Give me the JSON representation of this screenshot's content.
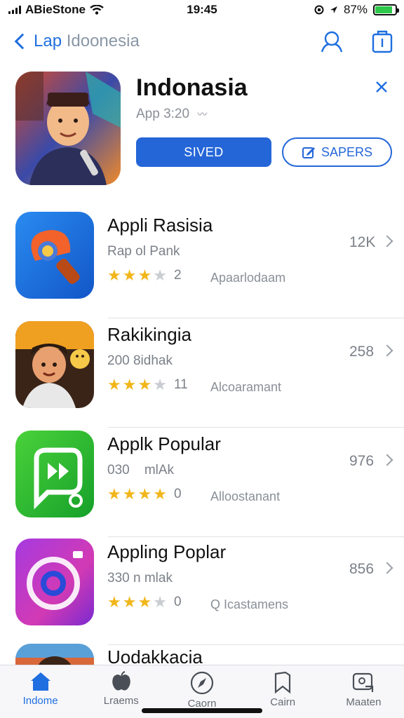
{
  "status_bar": {
    "carrier": "ABieStone",
    "time": "19:45",
    "battery": "87%",
    "battery_level": 0.87
  },
  "nav": {
    "back_label_prefix": "Lap",
    "back_label_rest": "Idoonesia"
  },
  "featured": {
    "title": "Indonasia",
    "subtitle": "App 3:20",
    "primary_button": "SIVED",
    "secondary_button": "SAPERS"
  },
  "apps": [
    {
      "name": "Appli Rasisia",
      "subtitle": "Rap ol Pank",
      "rating": 3,
      "rating_count": "2",
      "category": "Apaarlodaam",
      "size": "12K"
    },
    {
      "name": "Rakikingia",
      "subtitle": "200 8idhak",
      "rating": 3,
      "rating_count": "11",
      "category": "Alcoaramant",
      "size": "258"
    },
    {
      "name": "Applk Popular",
      "subtitle": "030    mlAk",
      "rating": 4,
      "rating_count": "0",
      "category": "Alloostanant",
      "size": "976"
    },
    {
      "name": "Appling Poplar",
      "subtitle": "330 n mlak",
      "rating": 3,
      "rating_count": "0",
      "category": "Q Icastamens",
      "size": "856"
    },
    {
      "name": "Uodakkacia",
      "subtitle": "",
      "rating": 0,
      "rating_count": "",
      "category": "",
      "size": ""
    }
  ],
  "tabs": [
    {
      "label": "Indome",
      "icon": "home-icon",
      "active": true
    },
    {
      "label": "Lraems",
      "icon": "apple-icon",
      "active": false
    },
    {
      "label": "Caorn",
      "icon": "compass-icon",
      "active": false
    },
    {
      "label": "Cairn",
      "icon": "bookmark-icon",
      "active": false
    },
    {
      "label": "Maaten",
      "icon": "profile-card-icon",
      "active": false
    }
  ],
  "colors": {
    "accent": "#1f6fe0",
    "button_blue": "#2466d8",
    "star": "#f2b61b",
    "battery": "#2ec94a"
  }
}
